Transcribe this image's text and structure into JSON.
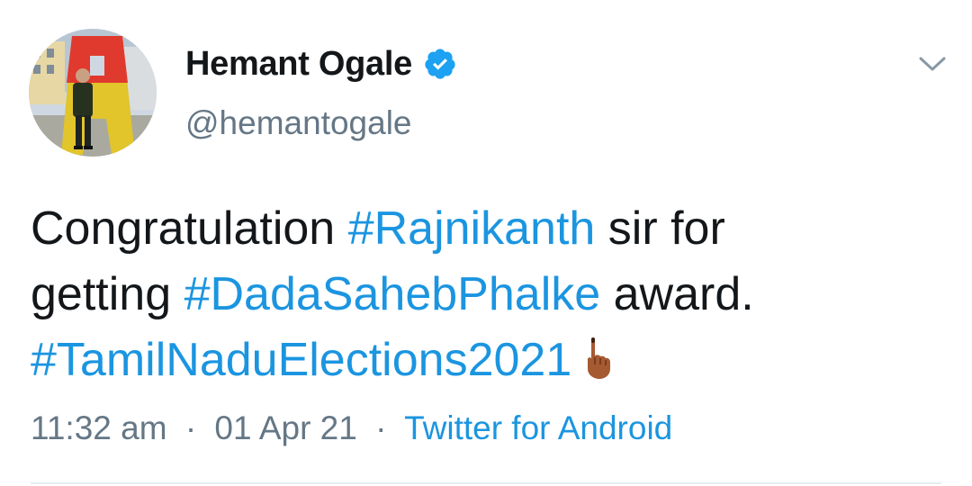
{
  "user": {
    "display_name": "Hemant Ogale",
    "handle": "@hemantogale",
    "verified": true,
    "avatar_icon": "profile-photo"
  },
  "tweet": {
    "segments": [
      [
        {
          "text": "Congratulation ",
          "type": "text"
        },
        {
          "text": "#Rajnikanth",
          "type": "hashtag"
        },
        {
          "text": " sir for",
          "type": "text"
        }
      ],
      [
        {
          "text": "getting ",
          "type": "text"
        },
        {
          "text": "#DadaSahebPhalke",
          "type": "hashtag"
        },
        {
          "text": " award.",
          "type": "text"
        }
      ],
      [
        {
          "text": "#TamilNaduElections2021",
          "type": "hashtag"
        }
      ]
    ],
    "emoji": "inked-finger-emoji"
  },
  "meta": {
    "time": "11:32 am",
    "dot1": "·",
    "date": "01 Apr 21",
    "dot2": "·",
    "source": "Twitter for Android"
  },
  "colors": {
    "link": "#1b95e0",
    "secondary": "#657786",
    "verified_badge": "#1da1f2"
  },
  "icons": {
    "menu": "chevron-down-icon",
    "verified": "verified-badge-icon"
  }
}
